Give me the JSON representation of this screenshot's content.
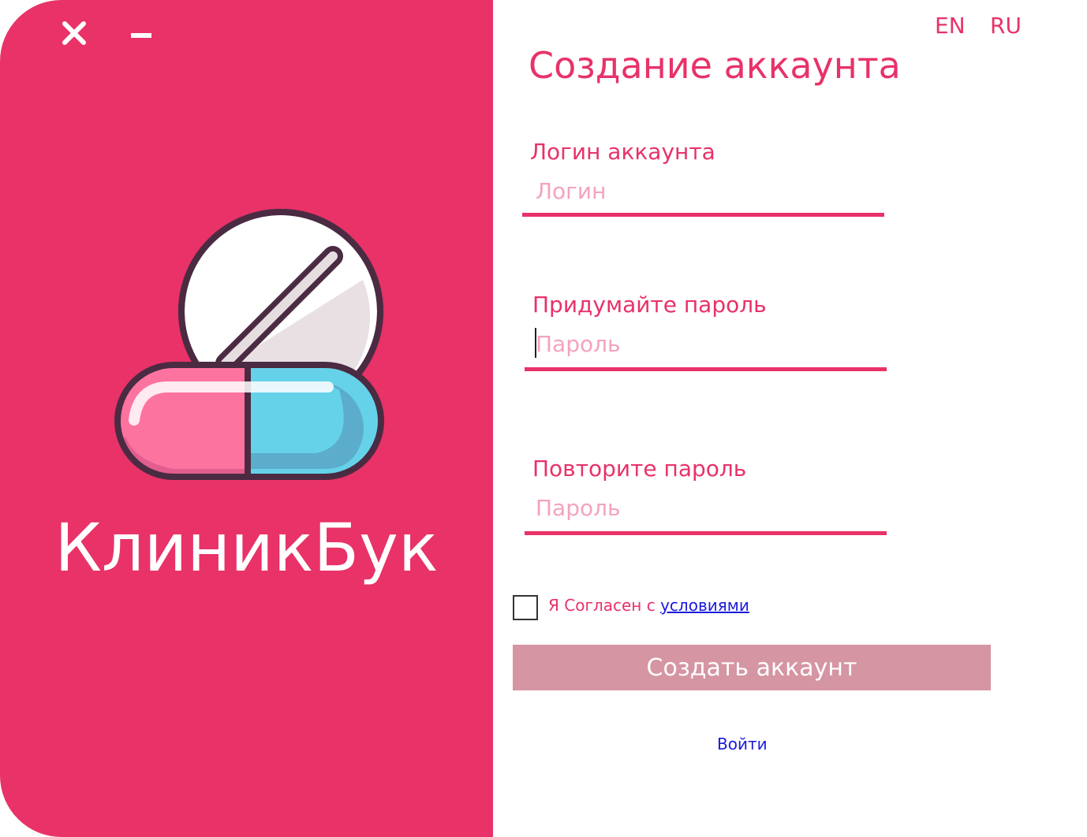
{
  "window": {
    "close_icon": "close-icon",
    "minimize_icon": "minimize-icon"
  },
  "brand": {
    "name": "КлиникБук",
    "logo_icon": "pill-capsule-logo"
  },
  "language": {
    "options": [
      "EN",
      "RU"
    ]
  },
  "form": {
    "title": "Создание аккаунта",
    "login": {
      "label": "Логин аккаунта",
      "placeholder": "Логин",
      "value": ""
    },
    "password": {
      "label": "Придумайте пароль",
      "placeholder": "Пароль",
      "value": ""
    },
    "password_repeat": {
      "label": "Повторите пароль",
      "placeholder": "Пароль",
      "value": ""
    },
    "agree": {
      "text": "Я Согласен с ",
      "link": "условиями",
      "checked": false
    },
    "submit_label": "Создать аккаунт",
    "login_link": "Войти"
  },
  "colors": {
    "accent": "#e83268",
    "button_disabled": "#d595a3",
    "link": "#1a1adb",
    "placeholder": "#f4a3bc"
  }
}
